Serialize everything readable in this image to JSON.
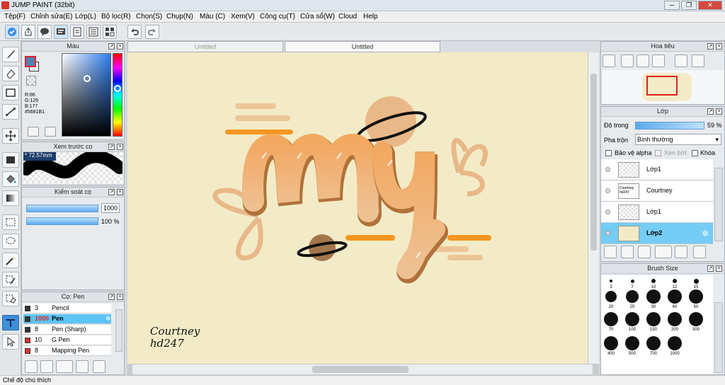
{
  "window": {
    "title": "JUMP PAINT (32bit)",
    "min": "─",
    "max": "❐",
    "close": "✕"
  },
  "menu": [
    "Tệp(F)",
    "Chỉnh sửa(E)",
    "Lớp(L)",
    "Bộ lọc(R)",
    "Chọn(S)",
    "Chụp(N)",
    "Màu (C)",
    "Xem(V)",
    "Công cụ(T)",
    "Cửa sổ(W)",
    "Cloud",
    "Help"
  ],
  "tabs": [
    "Untitled",
    "Untitled"
  ],
  "color_panel": {
    "title": "Màu",
    "r": "R:86",
    "g": "G:129",
    "b": "B:177",
    "hex": "#5681B1",
    "fg": "#5681B1",
    "bg": "#ffffff"
  },
  "brush_preview": {
    "title": "Xem trước cọ",
    "size": "72.57mm"
  },
  "brush_control": {
    "title": "Kiểm soát cọ",
    "size": "1000",
    "opacity": "100 %",
    "opacity_value": 1.0
  },
  "brush_list": {
    "title": "Cọ: Pen",
    "items": [
      {
        "n": "3",
        "name": "Pencil",
        "color": "#333333",
        "selected": false
      },
      {
        "n": "1000",
        "name": "Pen",
        "color": "#333333",
        "selected": true
      },
      {
        "n": "8",
        "name": "Pen (Sharp)",
        "color": "#333333",
        "selected": false
      },
      {
        "n": "10",
        "name": "G Pen",
        "color": "#e03030",
        "selected": false
      },
      {
        "n": "8",
        "name": "Mapping Pen",
        "color": "#e03030",
        "selected": false
      }
    ]
  },
  "artwork": {
    "name_line1": "Courtney",
    "name_line2": "hd247"
  },
  "navigator": {
    "title": "Hoa tiêu"
  },
  "layers": {
    "title": "Lớp",
    "opacity_label": "Độ trong",
    "opacity": "59 %",
    "opacity_value": 0.59,
    "blend_label": "Pha trộn",
    "blend": "Bình thường",
    "protect_alpha": "Bảo vệ alpha",
    "clipping": "Xén bớt",
    "lock": "Khóa",
    "items": [
      {
        "name": "Lớp1",
        "selected": false,
        "thumb_text": ""
      },
      {
        "name": "Courtney",
        "selected": false,
        "thumb_text": "Courtney hd247"
      },
      {
        "name": "Lớp1",
        "selected": false,
        "thumb_text": ""
      },
      {
        "name": "Lớp2",
        "selected": true,
        "thumb_text": ""
      }
    ]
  },
  "brush_size": {
    "title": "Brush Size",
    "sizes": [
      "3",
      "7",
      "10",
      "12",
      "15",
      "20",
      "25",
      "30",
      "40",
      "50",
      "70",
      "100",
      "150",
      "200",
      "300",
      "400",
      "500",
      "700",
      "1000"
    ]
  },
  "status": "Chế độ chú thích"
}
